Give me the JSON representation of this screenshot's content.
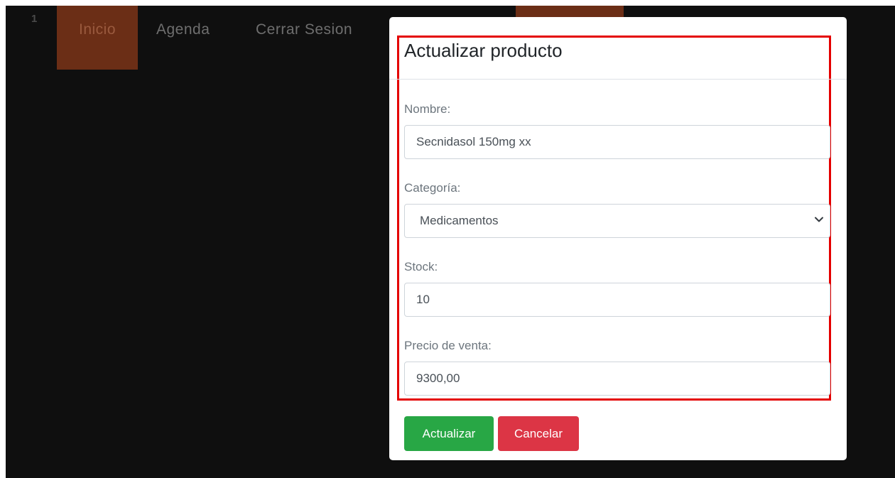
{
  "nav": {
    "number": "1",
    "items": [
      {
        "label": "Inicio"
      },
      {
        "label": "Agenda"
      },
      {
        "label": "Cerrar Sesion"
      }
    ]
  },
  "modal": {
    "title": "Actualizar producto",
    "fields": {
      "nombre": {
        "label": "Nombre:",
        "value": "Secnidasol 150mg xx"
      },
      "categoria": {
        "label": "Categoría:",
        "value": "Medicamentos"
      },
      "stock": {
        "label": "Stock:",
        "value": "10"
      },
      "precio": {
        "label": "Precio de venta:",
        "value": "9300,00"
      }
    },
    "buttons": {
      "update": "Actualizar",
      "cancel": "Cancelar"
    }
  },
  "colors": {
    "overlay_bg": "#0f0f0f",
    "nav_active": "#6b2e16",
    "highlight_border": "#e40000",
    "update_button": "#28a745",
    "cancel_button": "#dc3545"
  },
  "icons": {
    "select_arrow": "chevron-down-icon"
  }
}
